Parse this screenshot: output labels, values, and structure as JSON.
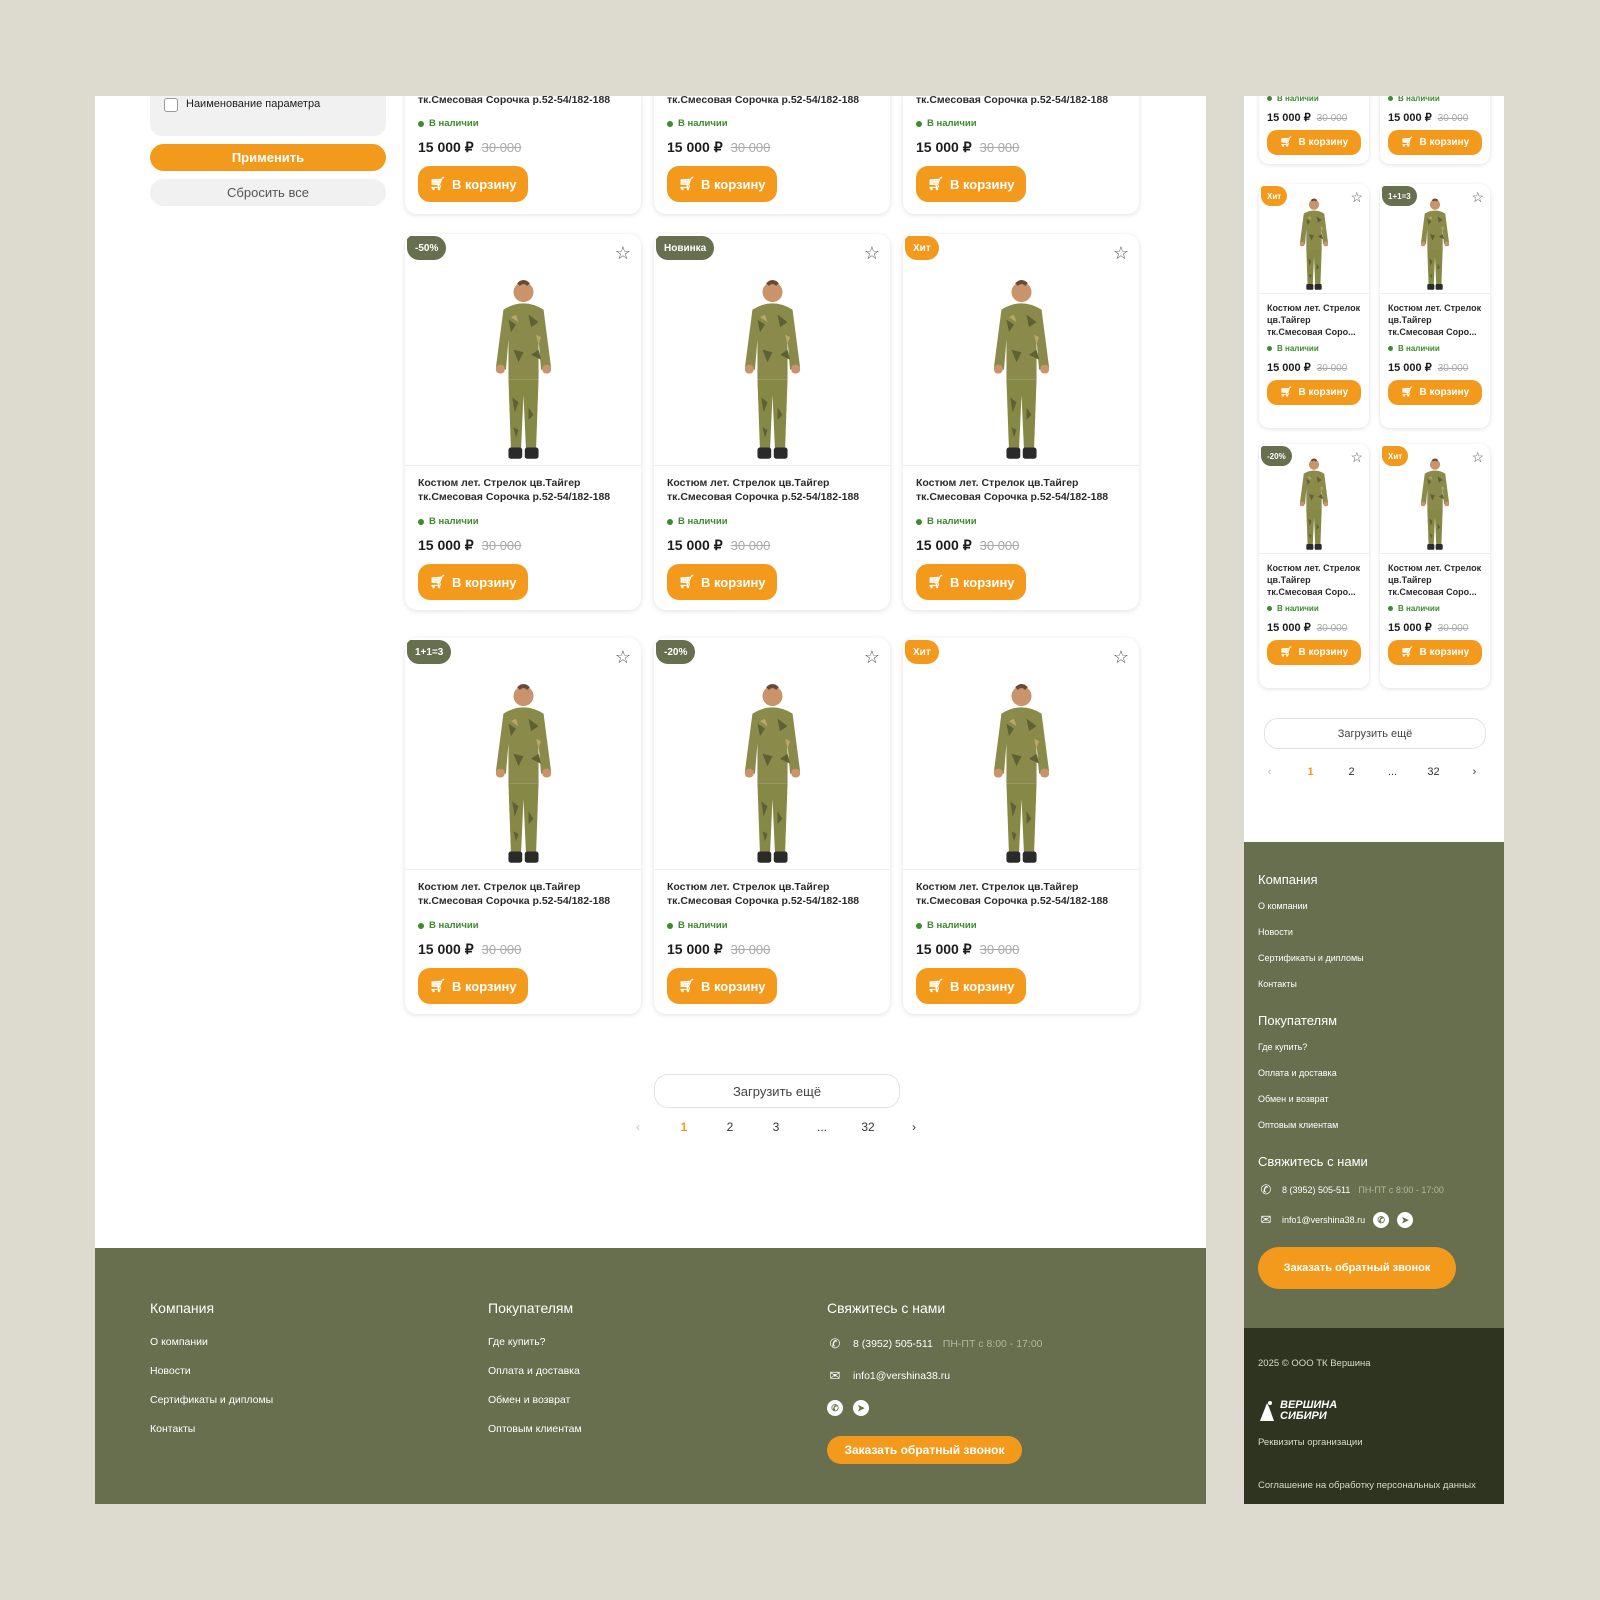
{
  "filter": {
    "param_label": "Наименование параметра",
    "apply": "Применить",
    "reset": "Сбросить все"
  },
  "product": {
    "title": "Костюм лет. Стрелок цв.Тайгер тк.Смесовая Сорочка р.52-54/182-188",
    "title_top": "тк.Смесовая Сорочка р.52-54/182-188",
    "title_short": "Костюм лет. Стрелок цв.Тайгер тк.Смесовая Соро...",
    "stock": "В наличии",
    "price": "15 000 ₽",
    "old_price": "30 000",
    "cart": "В корзину"
  },
  "badges": {
    "row2": [
      "-50%",
      "Новинка",
      "Хит"
    ],
    "row3": [
      "1+1=3",
      "-20%",
      "Хит"
    ],
    "mobile_row2": [
      "Хит",
      "1+1=3"
    ],
    "mobile_row3": [
      "-20%",
      "Хит"
    ]
  },
  "colors": {
    "accent": "#f39a1c",
    "badge_green": "#676f4e",
    "footer_bg": "#676f4e",
    "footer_dark": "#2f3421",
    "stock_green": "#3d8b2d"
  },
  "load_more": "Загрузить ещё",
  "pagination": {
    "prev": "‹",
    "pages": [
      "1",
      "2",
      "3",
      "...",
      "32"
    ],
    "mobile_pages": [
      "1",
      "2",
      "...",
      "32"
    ],
    "next": "›"
  },
  "footer": {
    "company_title": "Компания",
    "company_links": [
      "О компании",
      "Новости",
      "Сертификаты и дипломы",
      "Контакты"
    ],
    "buyers_title": "Покупателям",
    "buyers_links": [
      "Где купить?",
      "Оплата и доставка",
      "Обмен и возврат",
      "Оптовым клиентам"
    ],
    "contact_title": "Свяжитесь с нами",
    "phone": "8 (3952) 505-511",
    "hours": "ПН-ПТ с 8:00 - 17:00",
    "email": "info1@vershina38.ru",
    "callback": "Заказать обратный звонок",
    "copyright": "2025 © ООО ТК Вершина",
    "logo_line1": "ВЕРШИНА",
    "logo_line2": "СИБИРИ",
    "requisites": "Реквизиты организации",
    "agreement": "Соглашение на обработку персональных данных"
  },
  "icons": [
    "checkbox-icon",
    "star-icon",
    "cart-icon",
    "phone-icon",
    "mail-icon",
    "whatsapp-icon",
    "telegram-icon",
    "chevron-left-icon",
    "chevron-right-icon"
  ]
}
